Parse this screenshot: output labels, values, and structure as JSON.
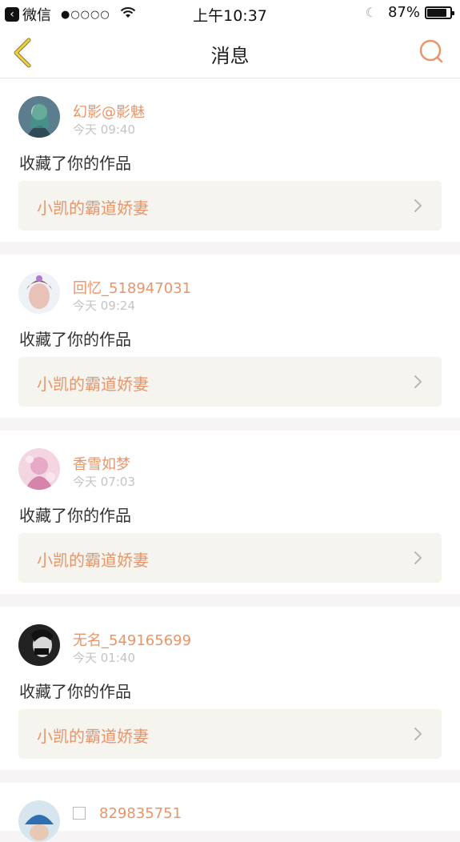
{
  "status_bar": {
    "carrier": "微信",
    "signal": "●○○○○",
    "time": "上午10:37",
    "battery_percent": "87%",
    "battery_level": 0.87
  },
  "nav": {
    "title": "消息",
    "back_icon": "chevron-left-icon",
    "search_icon": "search-icon"
  },
  "colors": {
    "accent": "#e8956a",
    "box_bg": "#f5f4ee",
    "separator": "#f6f4f4"
  },
  "messages": [
    {
      "user": "幻影@影魅",
      "time": "今天 09:40",
      "action": "收藏了你的作品",
      "work": "小凯的霸道娇妻"
    },
    {
      "user": "回忆_518947031",
      "time": "今天 09:24",
      "action": "收藏了你的作品",
      "work": "小凯的霸道娇妻"
    },
    {
      "user": "香雪如梦",
      "time": "今天 07:03",
      "action": "收藏了你的作品",
      "work": "小凯的霸道娇妻"
    },
    {
      "user": "无名_549165699",
      "time": "今天 01:40",
      "action": "收藏了你的作品",
      "work": "小凯的霸道娇妻"
    },
    {
      "user": "829835751"
    }
  ]
}
